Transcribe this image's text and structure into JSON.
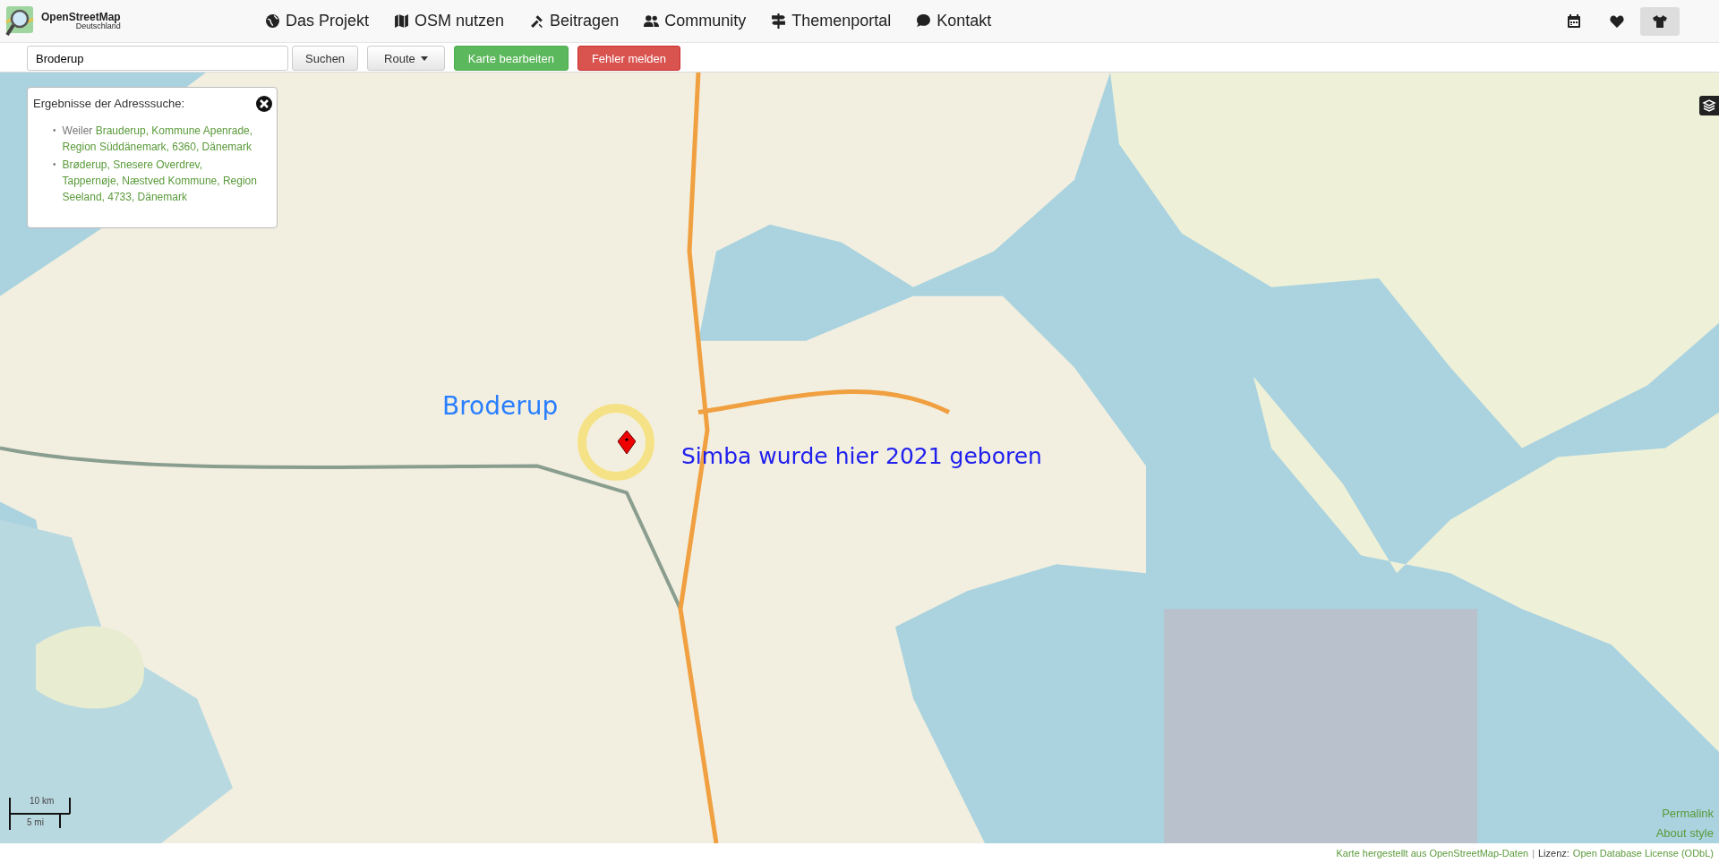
{
  "brand": {
    "name": "OpenStreetMap",
    "subtitle": "Deutschland"
  },
  "nav": [
    {
      "label": "Das Projekt"
    },
    {
      "label": "OSM nutzen"
    },
    {
      "label": "Beitragen"
    },
    {
      "label": "Community"
    },
    {
      "label": "Themenportal"
    },
    {
      "label": "Kontakt"
    }
  ],
  "nav_icons": [
    {
      "selected": false
    },
    {
      "selected": false
    },
    {
      "selected": true
    }
  ],
  "toolbar": {
    "search_value": "Broderup",
    "search_button": "Suchen",
    "route_button": "Route",
    "edit_button": "Karte bearbeiten",
    "report_button": "Fehler melden"
  },
  "results": {
    "title": "Ergebnisse der Adresssuche:",
    "items": [
      {
        "bullet": "•",
        "prefix": "Weiler",
        "link": "Brauderup, Kommune Apenrade, Region Süddänemark, 6360, Dänemark"
      },
      {
        "bullet": "•",
        "link": "Brøderup, Snesere Overdrev, Tappernøje, Næstved Kommune, Region Seeland, 4733, Dänemark"
      }
    ]
  },
  "annotations": [
    {
      "text": "Broderup",
      "color": "#2a7fff"
    },
    {
      "text": "Simba wurde hier 2021 geboren",
      "color": "#2020ee"
    }
  ],
  "scale": {
    "metric": "10 km",
    "imperial": "5 mi"
  },
  "map_links": [
    "Permalink",
    "About style"
  ],
  "footer": {
    "source_link": "Karte hergestellt aus OpenStreetMap-Daten",
    "separator": "|",
    "license_label": "Lizenz:",
    "license_link": "Open Database License (ODbL)"
  }
}
